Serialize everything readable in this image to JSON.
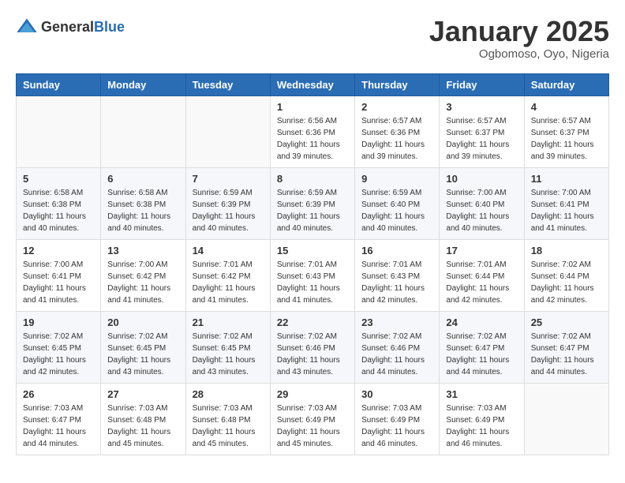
{
  "header": {
    "logo_general": "General",
    "logo_blue": "Blue",
    "month": "January 2025",
    "location": "Ogbomoso, Oyo, Nigeria"
  },
  "weekdays": [
    "Sunday",
    "Monday",
    "Tuesday",
    "Wednesday",
    "Thursday",
    "Friday",
    "Saturday"
  ],
  "weeks": [
    [
      {
        "day": "",
        "sunrise": "",
        "sunset": "",
        "daylight": ""
      },
      {
        "day": "",
        "sunrise": "",
        "sunset": "",
        "daylight": ""
      },
      {
        "day": "",
        "sunrise": "",
        "sunset": "",
        "daylight": ""
      },
      {
        "day": "1",
        "sunrise": "Sunrise: 6:56 AM",
        "sunset": "Sunset: 6:36 PM",
        "daylight": "Daylight: 11 hours and 39 minutes."
      },
      {
        "day": "2",
        "sunrise": "Sunrise: 6:57 AM",
        "sunset": "Sunset: 6:36 PM",
        "daylight": "Daylight: 11 hours and 39 minutes."
      },
      {
        "day": "3",
        "sunrise": "Sunrise: 6:57 AM",
        "sunset": "Sunset: 6:37 PM",
        "daylight": "Daylight: 11 hours and 39 minutes."
      },
      {
        "day": "4",
        "sunrise": "Sunrise: 6:57 AM",
        "sunset": "Sunset: 6:37 PM",
        "daylight": "Daylight: 11 hours and 39 minutes."
      }
    ],
    [
      {
        "day": "5",
        "sunrise": "Sunrise: 6:58 AM",
        "sunset": "Sunset: 6:38 PM",
        "daylight": "Daylight: 11 hours and 40 minutes."
      },
      {
        "day": "6",
        "sunrise": "Sunrise: 6:58 AM",
        "sunset": "Sunset: 6:38 PM",
        "daylight": "Daylight: 11 hours and 40 minutes."
      },
      {
        "day": "7",
        "sunrise": "Sunrise: 6:59 AM",
        "sunset": "Sunset: 6:39 PM",
        "daylight": "Daylight: 11 hours and 40 minutes."
      },
      {
        "day": "8",
        "sunrise": "Sunrise: 6:59 AM",
        "sunset": "Sunset: 6:39 PM",
        "daylight": "Daylight: 11 hours and 40 minutes."
      },
      {
        "day": "9",
        "sunrise": "Sunrise: 6:59 AM",
        "sunset": "Sunset: 6:40 PM",
        "daylight": "Daylight: 11 hours and 40 minutes."
      },
      {
        "day": "10",
        "sunrise": "Sunrise: 7:00 AM",
        "sunset": "Sunset: 6:40 PM",
        "daylight": "Daylight: 11 hours and 40 minutes."
      },
      {
        "day": "11",
        "sunrise": "Sunrise: 7:00 AM",
        "sunset": "Sunset: 6:41 PM",
        "daylight": "Daylight: 11 hours and 41 minutes."
      }
    ],
    [
      {
        "day": "12",
        "sunrise": "Sunrise: 7:00 AM",
        "sunset": "Sunset: 6:41 PM",
        "daylight": "Daylight: 11 hours and 41 minutes."
      },
      {
        "day": "13",
        "sunrise": "Sunrise: 7:00 AM",
        "sunset": "Sunset: 6:42 PM",
        "daylight": "Daylight: 11 hours and 41 minutes."
      },
      {
        "day": "14",
        "sunrise": "Sunrise: 7:01 AM",
        "sunset": "Sunset: 6:42 PM",
        "daylight": "Daylight: 11 hours and 41 minutes."
      },
      {
        "day": "15",
        "sunrise": "Sunrise: 7:01 AM",
        "sunset": "Sunset: 6:43 PM",
        "daylight": "Daylight: 11 hours and 41 minutes."
      },
      {
        "day": "16",
        "sunrise": "Sunrise: 7:01 AM",
        "sunset": "Sunset: 6:43 PM",
        "daylight": "Daylight: 11 hours and 42 minutes."
      },
      {
        "day": "17",
        "sunrise": "Sunrise: 7:01 AM",
        "sunset": "Sunset: 6:44 PM",
        "daylight": "Daylight: 11 hours and 42 minutes."
      },
      {
        "day": "18",
        "sunrise": "Sunrise: 7:02 AM",
        "sunset": "Sunset: 6:44 PM",
        "daylight": "Daylight: 11 hours and 42 minutes."
      }
    ],
    [
      {
        "day": "19",
        "sunrise": "Sunrise: 7:02 AM",
        "sunset": "Sunset: 6:45 PM",
        "daylight": "Daylight: 11 hours and 42 minutes."
      },
      {
        "day": "20",
        "sunrise": "Sunrise: 7:02 AM",
        "sunset": "Sunset: 6:45 PM",
        "daylight": "Daylight: 11 hours and 43 minutes."
      },
      {
        "day": "21",
        "sunrise": "Sunrise: 7:02 AM",
        "sunset": "Sunset: 6:45 PM",
        "daylight": "Daylight: 11 hours and 43 minutes."
      },
      {
        "day": "22",
        "sunrise": "Sunrise: 7:02 AM",
        "sunset": "Sunset: 6:46 PM",
        "daylight": "Daylight: 11 hours and 43 minutes."
      },
      {
        "day": "23",
        "sunrise": "Sunrise: 7:02 AM",
        "sunset": "Sunset: 6:46 PM",
        "daylight": "Daylight: 11 hours and 44 minutes."
      },
      {
        "day": "24",
        "sunrise": "Sunrise: 7:02 AM",
        "sunset": "Sunset: 6:47 PM",
        "daylight": "Daylight: 11 hours and 44 minutes."
      },
      {
        "day": "25",
        "sunrise": "Sunrise: 7:02 AM",
        "sunset": "Sunset: 6:47 PM",
        "daylight": "Daylight: 11 hours and 44 minutes."
      }
    ],
    [
      {
        "day": "26",
        "sunrise": "Sunrise: 7:03 AM",
        "sunset": "Sunset: 6:47 PM",
        "daylight": "Daylight: 11 hours and 44 minutes."
      },
      {
        "day": "27",
        "sunrise": "Sunrise: 7:03 AM",
        "sunset": "Sunset: 6:48 PM",
        "daylight": "Daylight: 11 hours and 45 minutes."
      },
      {
        "day": "28",
        "sunrise": "Sunrise: 7:03 AM",
        "sunset": "Sunset: 6:48 PM",
        "daylight": "Daylight: 11 hours and 45 minutes."
      },
      {
        "day": "29",
        "sunrise": "Sunrise: 7:03 AM",
        "sunset": "Sunset: 6:49 PM",
        "daylight": "Daylight: 11 hours and 45 minutes."
      },
      {
        "day": "30",
        "sunrise": "Sunrise: 7:03 AM",
        "sunset": "Sunset: 6:49 PM",
        "daylight": "Daylight: 11 hours and 46 minutes."
      },
      {
        "day": "31",
        "sunrise": "Sunrise: 7:03 AM",
        "sunset": "Sunset: 6:49 PM",
        "daylight": "Daylight: 11 hours and 46 minutes."
      },
      {
        "day": "",
        "sunrise": "",
        "sunset": "",
        "daylight": ""
      }
    ]
  ]
}
